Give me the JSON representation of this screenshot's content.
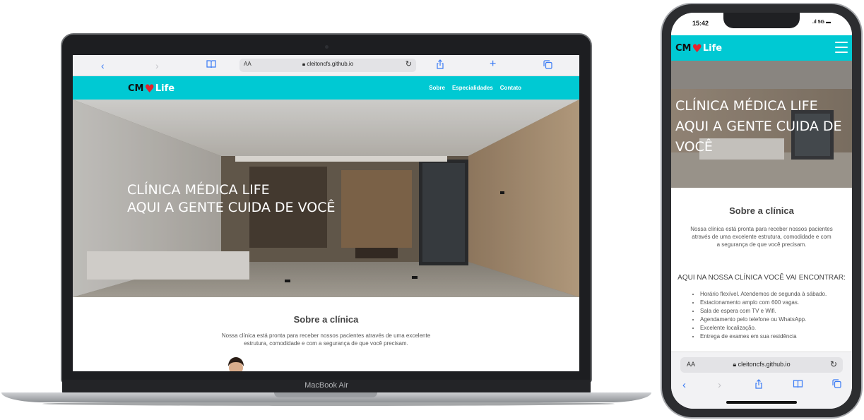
{
  "laptop": {
    "brand": "MacBook Air",
    "browser": {
      "text_size_label": "AA",
      "url": "cleitoncfs.github.io"
    },
    "site": {
      "logo": {
        "prefix": "CM",
        "heart": "♥",
        "suffix": "Life"
      },
      "nav_links": [
        "Sobre",
        "Especialidades",
        "Contato"
      ],
      "hero_line1": "CLÍNICA MÉDICA LIFE",
      "hero_line2": "AQUI A GENTE CUIDA DE VOCÊ",
      "about_title": "Sobre a clínica",
      "about_text": "Nossa clínica está pronta para receber nossos pacientes através de uma excelente estrutura, comodidade e com a segurança de que você precisam."
    }
  },
  "phone": {
    "status": {
      "time": "15:42",
      "network": "5G"
    },
    "site": {
      "logo": {
        "prefix": "CM",
        "heart": "♥",
        "suffix": "Life"
      },
      "hero_line1": "CLÍNICA MÉDICA LIFE",
      "hero_line2": "AQUI A GENTE CUIDA DE",
      "hero_line3": "VOCÊ",
      "about_title": "Sobre a clínica",
      "about_text": "Nossa clínica está pronta para receber nossos pacientes através de uma excelente estrutura, comodidade e com a segurança de que você precisam.",
      "features_title": "AQUI NA NOSSA CLÍNICA VOCÊ VAI ENCONTRAR:",
      "features": [
        "Horário flexível. Atendemos de segunda à sábado.",
        "Estacionamento amplo com 600 vagas.",
        "Sala de espera com TV e Wifi.",
        "Agendamento pelo telefone ou WhatsApp.",
        "Excelente localização.",
        "Entrega de exames em sua residência"
      ]
    },
    "browser": {
      "text_size_label": "AA",
      "url": "cleitoncfs.github.io"
    }
  },
  "colors": {
    "nav_bg": "#00c9d3",
    "heart": "#e3222c",
    "ios_blue": "#3a7bf5"
  }
}
